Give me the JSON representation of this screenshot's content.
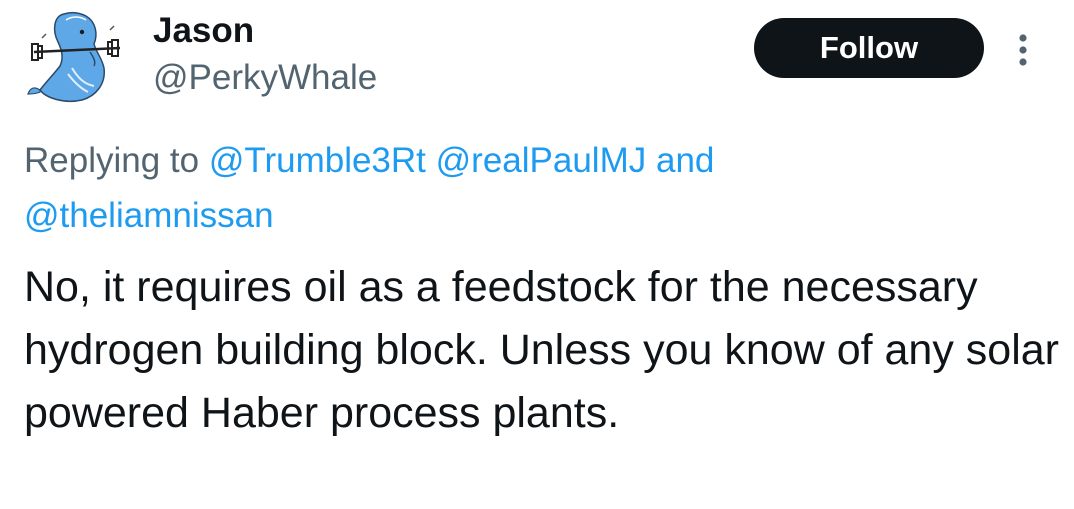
{
  "user": {
    "display_name": "Jason",
    "handle": "@PerkyWhale",
    "avatar_icon": "whale-lifting-barbell-icon"
  },
  "actions": {
    "follow_label": "Follow",
    "more_icon": "more-vertical-icon"
  },
  "reply_context": {
    "prefix": "Replying to",
    "mentions": [
      "@Trumble3Rt",
      "@realPaulMJ",
      "@theliamnissan"
    ],
    "conjunction": "and"
  },
  "tweet": {
    "text": "No, it requires oil as a feedstock for the necessary hydrogen building block. Unless you know of any solar powered Haber process plants."
  },
  "colors": {
    "text_primary": "#0f1419",
    "text_secondary": "#536471",
    "link": "#1d9bf0",
    "button_bg": "#0f1419",
    "button_text": "#ffffff"
  }
}
